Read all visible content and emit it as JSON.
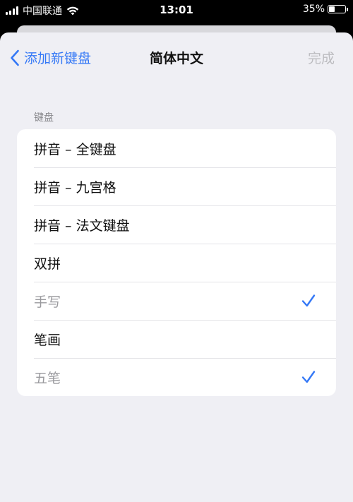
{
  "status_bar": {
    "carrier": "中国联通",
    "time": "13:01",
    "battery_percent": "35%",
    "battery_level": 0.35,
    "icons": [
      "signal-icon",
      "wifi-icon",
      "battery-icon"
    ]
  },
  "nav": {
    "back_label": "添加新键盘",
    "title": "简体中文",
    "done_label": "完成"
  },
  "section": {
    "header": "键盘",
    "items": [
      {
        "label": "拼音 – 全键盘",
        "checked": false,
        "disabled": false
      },
      {
        "label": "拼音 – 九宫格",
        "checked": false,
        "disabled": false
      },
      {
        "label": "拼音 – 法文键盘",
        "checked": false,
        "disabled": false
      },
      {
        "label": "双拼",
        "checked": false,
        "disabled": false
      },
      {
        "label": "手写",
        "checked": true,
        "disabled": true
      },
      {
        "label": "笔画",
        "checked": false,
        "disabled": false
      },
      {
        "label": "五笔",
        "checked": true,
        "disabled": true
      }
    ]
  },
  "colors": {
    "accent": "#3478f6",
    "background": "#efeff4",
    "disabled_text": "#9a9a9e"
  }
}
